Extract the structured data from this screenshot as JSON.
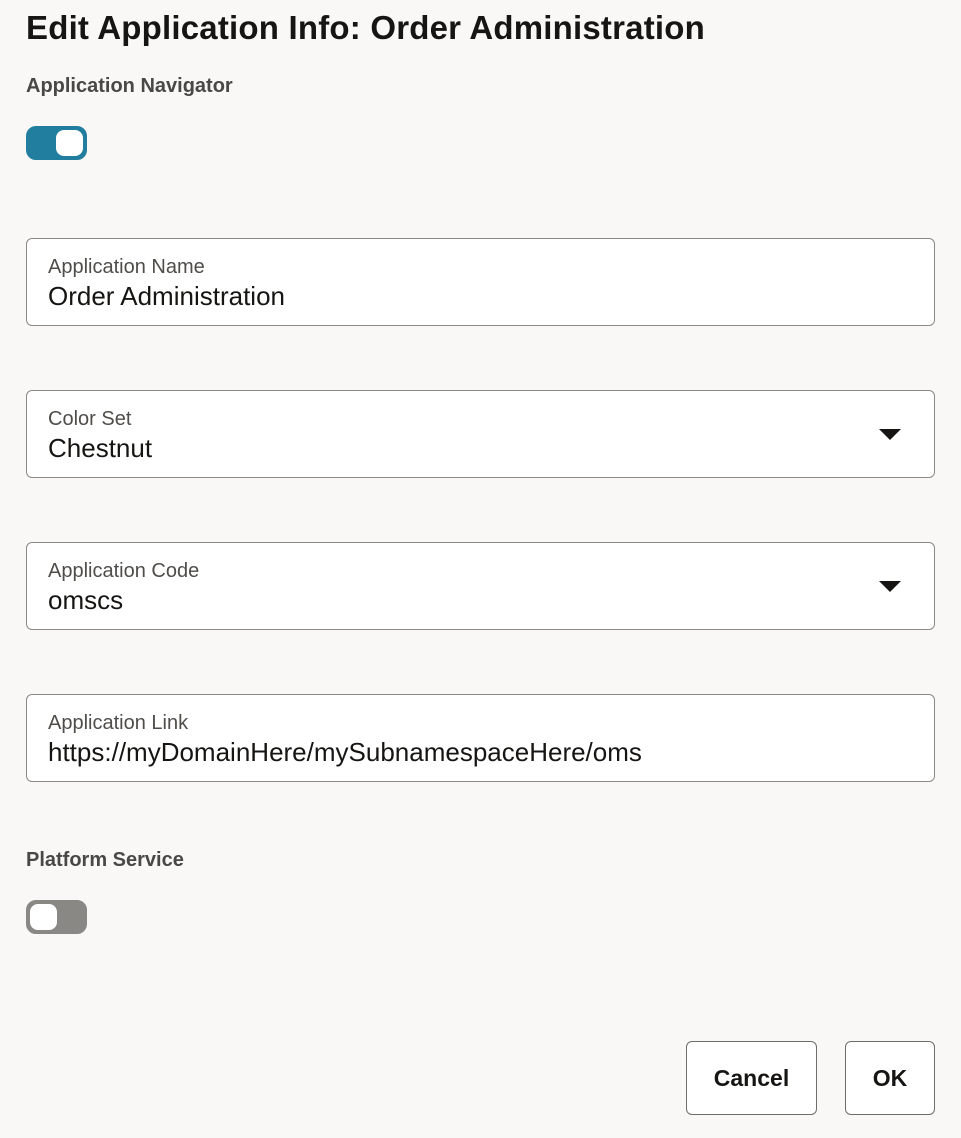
{
  "dialog": {
    "title": "Edit Application Info: Order Administration"
  },
  "application_navigator": {
    "label": "Application Navigator",
    "enabled": true
  },
  "fields": {
    "application_name": {
      "label": "Application Name",
      "value": "Order Administration"
    },
    "color_set": {
      "label": "Color Set",
      "value": "Chestnut",
      "icon": "chevron-down-icon"
    },
    "application_code": {
      "label": "Application Code",
      "value": "omscs",
      "icon": "chevron-down-icon"
    },
    "application_link": {
      "label": "Application Link",
      "value": "https://myDomainHere/mySubnamespaceHere/oms"
    }
  },
  "platform_service": {
    "label": "Platform Service",
    "enabled": false
  },
  "buttons": {
    "cancel_label": "Cancel",
    "ok_label": "OK"
  },
  "colors": {
    "toggle_on": "#227e9e",
    "toggle_off": "#8a8885",
    "background": "#f9f8f6"
  }
}
